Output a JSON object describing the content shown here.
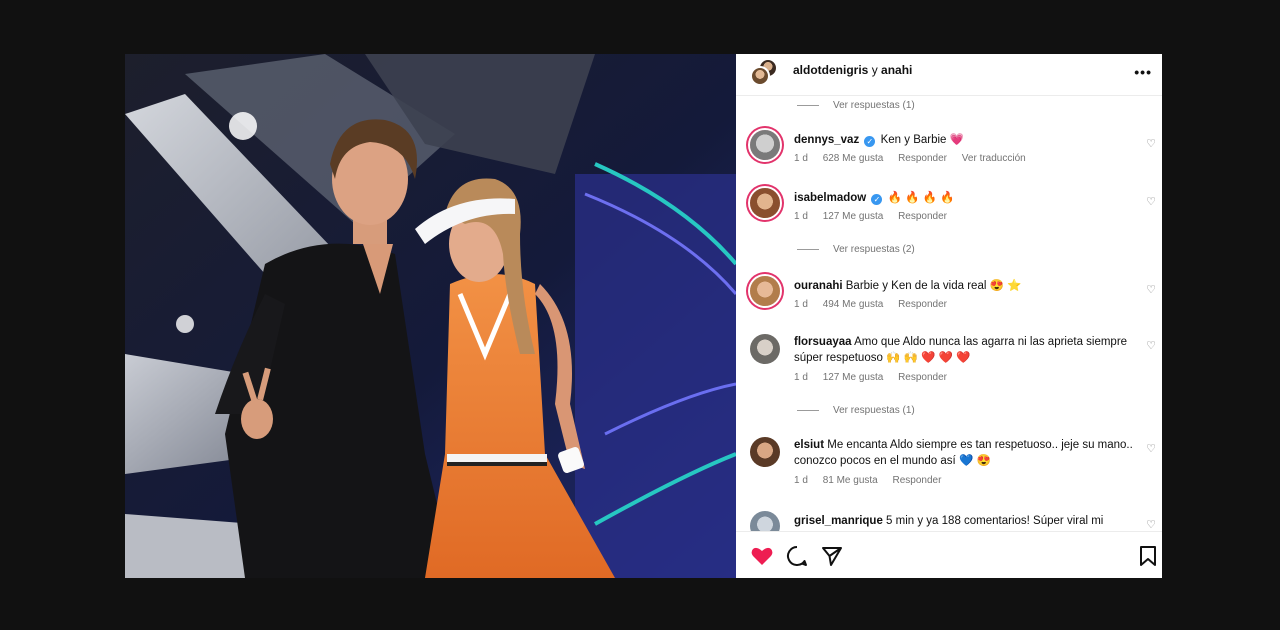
{
  "post": {
    "header": {
      "user1": "aldotdenigris",
      "conjunction": "y",
      "user2": "anahi",
      "more": "•••"
    },
    "comments": [
      {
        "type": "replies",
        "label": "Ver respuestas (1)"
      },
      {
        "type": "comment",
        "user": "dennys_vaz",
        "verified": true,
        "text": "Ken y Barbie",
        "emoji": "💗",
        "time": "1 d",
        "likes": "628 Me gusta",
        "reply": "Responder",
        "translate": "Ver traducción"
      },
      {
        "type": "comment",
        "user": "isabelmadow",
        "verified": true,
        "text": "",
        "emoji": "🔥 🔥 🔥 🔥",
        "time": "1 d",
        "likes": "127 Me gusta",
        "reply": "Responder"
      },
      {
        "type": "replies",
        "label": "Ver respuestas (2)"
      },
      {
        "type": "comment",
        "user": "ouranahi",
        "verified": false,
        "text": "Barbie y Ken de la vida real",
        "emoji": "😍 ⭐",
        "time": "1 d",
        "likes": "494 Me gusta",
        "reply": "Responder"
      },
      {
        "type": "comment",
        "user": "florsuayaa",
        "verified": false,
        "text": "Amo que Aldo nunca las agarra ni las aprieta siempre súper respetuoso",
        "emoji": "🙌 🙌 ❤️ ❤️ ❤️",
        "time": "1 d",
        "likes": "127 Me gusta",
        "reply": "Responder"
      },
      {
        "type": "replies",
        "label": "Ver respuestas (1)"
      },
      {
        "type": "comment",
        "user": "elsiut",
        "verified": false,
        "text": "Me encanta Aldo siempre es tan respetuoso.. jeje su mano.. conozco pocos en el mundo así",
        "emoji": "💙 😍",
        "time": "1 d",
        "likes": "81 Me gusta",
        "reply": "Responder"
      },
      {
        "type": "comment",
        "user": "grisel_manrique",
        "verified": false,
        "text": "5 min y ya 188 comentarios! Súper viral mi",
        "emoji": "",
        "time": "",
        "likes": "",
        "reply": ""
      }
    ],
    "actions": {
      "like": "heart-filled-icon",
      "comment": "comment-icon",
      "share": "share-icon",
      "save": "bookmark-icon"
    }
  },
  "colors": {
    "like_red": "#ee1d52",
    "verified_blue": "#3897f0",
    "meta_gray": "#737373",
    "dress_orange": "#f07a2a"
  }
}
